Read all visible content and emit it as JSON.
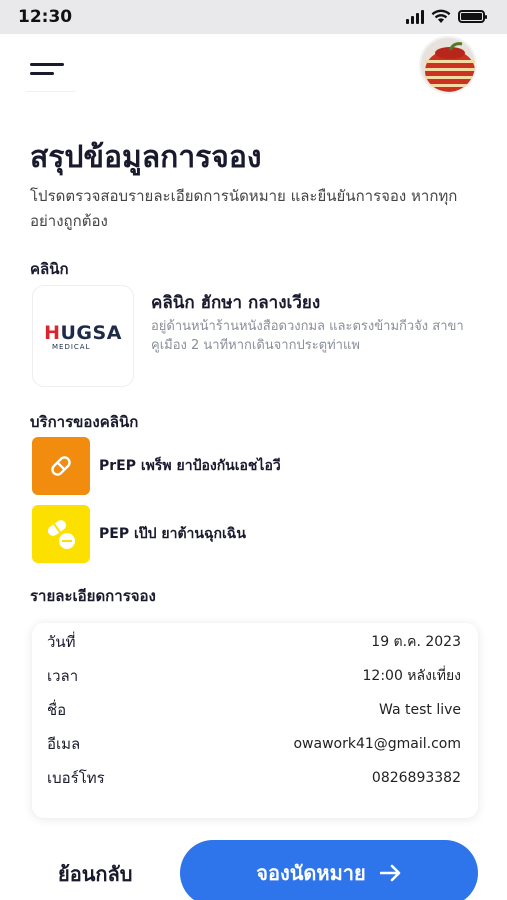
{
  "status_bar": {
    "time": "12:30",
    "icons": [
      "signal-icon",
      "wifi-icon",
      "battery-icon"
    ]
  },
  "header": {
    "menu_icon": "menu-icon",
    "avatar": "user-avatar"
  },
  "page": {
    "title": "สรุปข้อมูลการจอง",
    "subtitle": "โปรดตรวจสอบรายละเอียดการนัดหมาย และยืนยันการจอง หากทุกอย่างถูกต้อง"
  },
  "clinic_section": {
    "label": "คลินิก",
    "logo": {
      "text_red": "H",
      "text_main": "UGSA",
      "subtext": "MEDICAL"
    },
    "name": "คลินิก ฮักษา กลางเวียง",
    "address": "อยู่ด้านหน้าร้านหนังสือดวงกมล และตรงข้ามกีวจัง สาขาคูเมือง 2 นาทีหากเดินจากประตูท่าแพ"
  },
  "services_section": {
    "label": "บริการของคลินิก",
    "items": [
      {
        "label": "PrEP เพร็พ ยาป้องกันเอชไอวี",
        "icon": "pill-icon",
        "color": "#f28c0f"
      },
      {
        "label": "PEP เป๊ป ยาต้านฉุกเฉิน",
        "icon": "pills-icon",
        "color": "#fce000"
      }
    ]
  },
  "booking_section": {
    "label": "รายละเอียดการจอง",
    "rows": [
      {
        "label": "วันที่",
        "value": "19 ต.ค. 2023"
      },
      {
        "label": "เวลา",
        "value": "12:00 หลังเที่ยง"
      },
      {
        "label": "ชื่อ",
        "value": "Wa test live"
      },
      {
        "label": "อีเมล",
        "value": "owawork41@gmail.com"
      },
      {
        "label": "เบอร์โทร",
        "value": "0826893382"
      }
    ]
  },
  "footer": {
    "back_label": "ย้อนกลับ",
    "confirm_label": "จองนัดหมาย",
    "confirm_icon": "arrow-right-icon",
    "accent_color": "#2e74ea"
  }
}
